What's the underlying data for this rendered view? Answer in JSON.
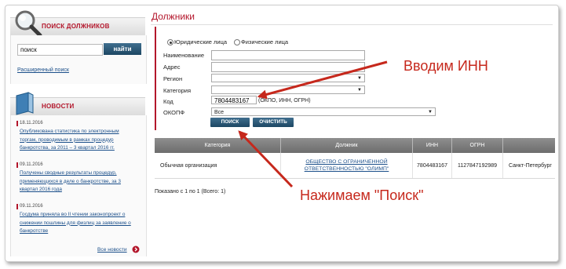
{
  "sidebar": {
    "search_panel_title": "ПОИСК ДОЛЖНИКОВ",
    "search_value": "поиск",
    "search_button": "найти",
    "advanced_search_link": "Расширенный поиск",
    "news_panel_title": "НОВОСТИ",
    "news": [
      {
        "date": "18.11.2016",
        "text": "Опубликована статистика по электронным торгам, проводимым в рамках процедур банкротства, за 2011 – 3 квартал 2016 гг."
      },
      {
        "date": "09.11.2016",
        "text": "Получены сводные результаты процедур, применяющихся в деле о банкротстве, за 3 квартал 2016 года"
      },
      {
        "date": "09.11.2016",
        "text": "Госдума приняла во II чтении законопроект о снижении пошлины для физлиц за заявление о банкротстве"
      }
    ],
    "all_news_link": "Все новости"
  },
  "main": {
    "title": "Должники",
    "radio_legal": "Юридические лица",
    "radio_individual": "Физические лица",
    "labels": {
      "name": "Наименование",
      "address": "Адрес",
      "region": "Регион",
      "category": "Категория",
      "code": "Код",
      "okopf": "ОКОПФ"
    },
    "code_value": "7804483167",
    "code_hint": "(ОКПО, ИНН, ОГРН)",
    "okopf_value": "Все",
    "search_button": "ПОИСК",
    "clear_button": "ОЧИСТИТЬ"
  },
  "table": {
    "headers": [
      "Категория",
      "Должник",
      "ИНН",
      "ОГРН",
      ""
    ],
    "row": {
      "category": "Обычная организация",
      "debtor": "ОБЩЕСТВО С ОГРАНИЧЕННОЙ ОТВЕТСТВЕННОСТЬЮ \"ОЛИМП\"",
      "inn": "7804483167",
      "ogrn": "1127847192989",
      "region": "Санкт-Петербург"
    },
    "summary": "Показано с 1 по 1 (Всего: 1)"
  },
  "annotations": {
    "enter_inn": "Вводим ИНН",
    "press_search": "Нажимаем \"Поиск\""
  },
  "colors": {
    "brand_red": "#b3162b",
    "button_blue": "#1d4763",
    "annotation_red": "#c6281c"
  }
}
